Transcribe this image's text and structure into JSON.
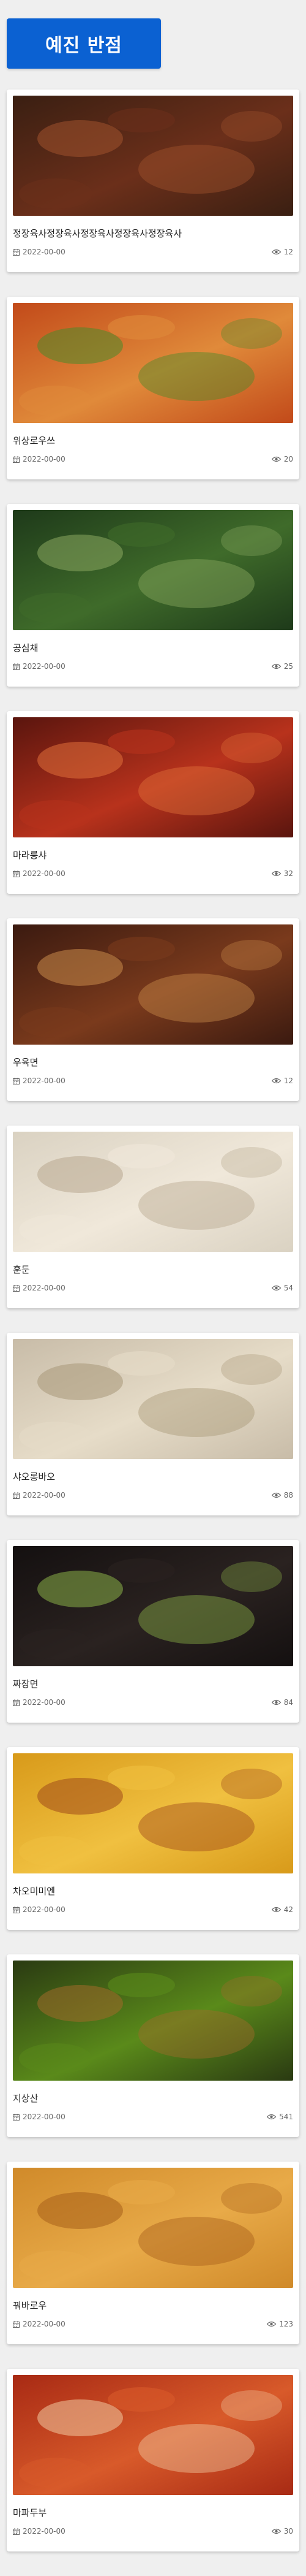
{
  "header": {
    "title": "예진 반점"
  },
  "items": [
    {
      "name": "정장육사정장육사정장육사정장육사정장육사",
      "date": "2022-00-00",
      "views": "12",
      "image": "braised-pork-ribs-photo",
      "colors": [
        "#3a1f12",
        "#6b2f1a",
        "#a0522d"
      ]
    },
    {
      "name": "위샹로우쓰",
      "date": "2022-00-00",
      "views": "20",
      "image": "yuxiang-shredded-pork-photo",
      "colors": [
        "#c24a1a",
        "#e08a3a",
        "#4a8a2a"
      ]
    },
    {
      "name": "공심채",
      "date": "2022-00-00",
      "views": "25",
      "image": "stir-fried-water-spinach-photo",
      "colors": [
        "#1e3a1a",
        "#3f6b2a",
        "#8aa860"
      ]
    },
    {
      "name": "마라룽샤",
      "date": "2022-00-00",
      "views": "32",
      "image": "spicy-crayfish-photo",
      "colors": [
        "#5a150e",
        "#b8321c",
        "#e0703a"
      ]
    },
    {
      "name": "우육면",
      "date": "2022-00-00",
      "views": "12",
      "image": "beef-noodle-soup-photo",
      "colors": [
        "#3b1a10",
        "#7a3a1c",
        "#c88a4a"
      ]
    },
    {
      "name": "훈둔",
      "date": "2022-00-00",
      "views": "54",
      "image": "wonton-photo",
      "colors": [
        "#dad2c2",
        "#f0e8da",
        "#b8a890"
      ]
    },
    {
      "name": "샤오롱바오",
      "date": "2022-00-00",
      "views": "88",
      "image": "xiaolongbao-photo",
      "colors": [
        "#c8bca8",
        "#e6dcc8",
        "#a89878"
      ]
    },
    {
      "name": "짜장면",
      "date": "2022-00-00",
      "views": "84",
      "image": "jajangmyeon-photo",
      "colors": [
        "#141010",
        "#2a2220",
        "#8ab048"
      ]
    },
    {
      "name": "차오미미엔",
      "date": "2022-00-00",
      "views": "42",
      "image": "fried-noodles-photo",
      "colors": [
        "#d89a1a",
        "#f0c040",
        "#a04a1a"
      ]
    },
    {
      "name": "지상산",
      "date": "2022-00-00",
      "views": "541",
      "image": "di-san-xian-photo",
      "colors": [
        "#2a3a12",
        "#5a8a1a",
        "#a06a2a"
      ]
    },
    {
      "name": "꿔바로우",
      "date": "2022-00-00",
      "views": "123",
      "image": "guobaorou-photo",
      "colors": [
        "#d08a2a",
        "#e8aa48",
        "#a8601a"
      ]
    },
    {
      "name": "마파두부",
      "date": "2022-00-00",
      "views": "30",
      "image": "mapo-tofu-photo",
      "colors": [
        "#a82a14",
        "#d85a2a",
        "#f0c8a0"
      ]
    }
  ],
  "icons": {
    "date": "calendar-icon",
    "views": "eye-icon"
  }
}
